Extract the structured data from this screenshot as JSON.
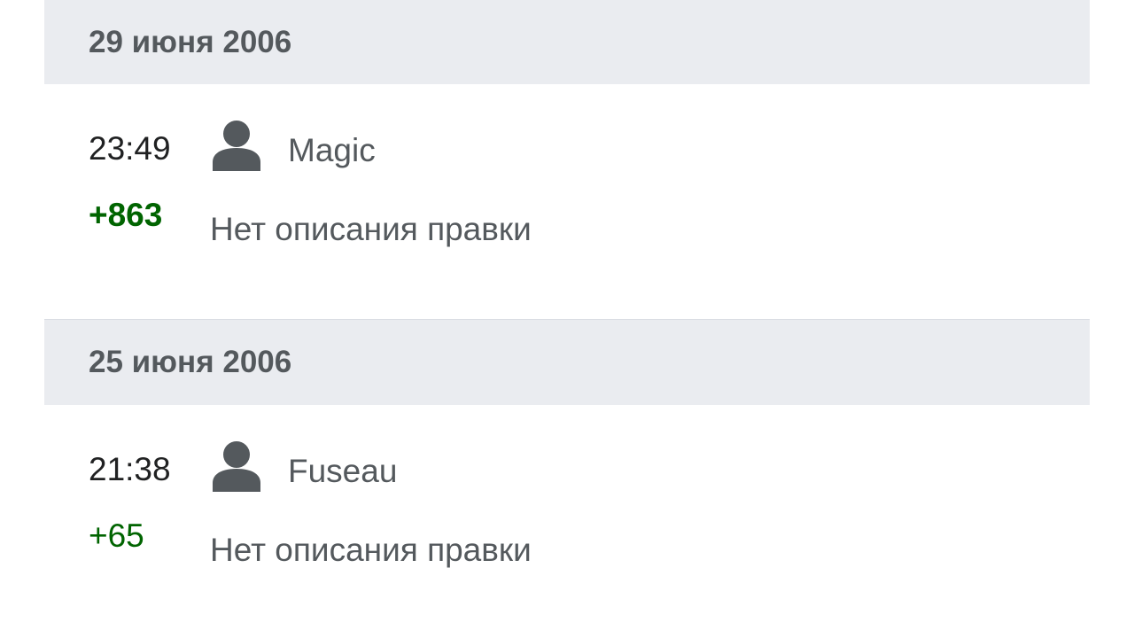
{
  "history": [
    {
      "date": "29 июня 2006",
      "revisions": [
        {
          "time": "23:49",
          "user_icon": "user-icon",
          "user": "Magic",
          "bytes": "+863",
          "summary": "Нет описания правки"
        }
      ]
    },
    {
      "date": "25 июня 2006",
      "revisions": [
        {
          "time": "21:38",
          "user_icon": "user-icon",
          "user": "Fuseau",
          "bytes": "+65",
          "summary": "Нет описания правки"
        }
      ]
    }
  ],
  "colors": {
    "header_bg": "#eaecf0",
    "header_text": "#54595d",
    "positive_bytes": "#006400",
    "icon": "#54595d"
  }
}
